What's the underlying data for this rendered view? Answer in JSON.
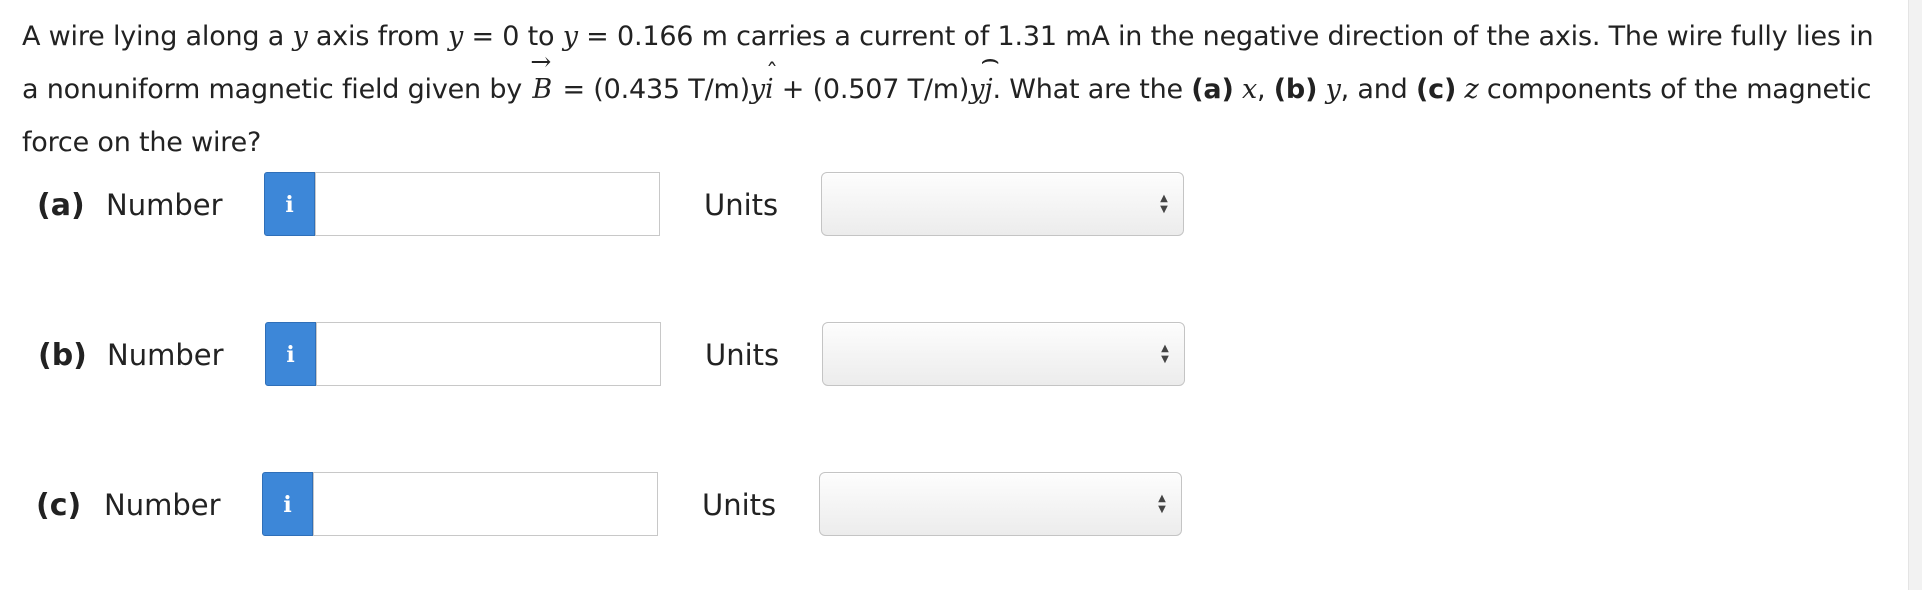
{
  "question": {
    "t1": "A wire lying along a ",
    "var_y1": "y",
    "t2": " axis from ",
    "var_y2": "y",
    "t3": " = 0 to ",
    "var_y3": "y",
    "t4": " = 0.166 m carries a current of 1.31 mA in the negative direction of the axis. The wire fully lies in a nonuniform magnetic field given by ",
    "var_B": "B",
    "t5": " = (0.435 T/m)",
    "var_y4": "y",
    "var_i": "i",
    "t6": " + (0.507 T/m)",
    "var_y5": "y",
    "var_j": "j",
    "t7": ". What are the ",
    "a_tag": "(a)",
    "var_x": " x",
    "t8": ", ",
    "b_tag": "(b)",
    "var_y6": " y",
    "t9": ", and ",
    "c_tag": "(c)",
    "var_z": " z",
    "t10": " components of the magnetic force on the wire?"
  },
  "rows": [
    {
      "label": "(a)",
      "number_label": "Number",
      "info_icon": "info-icon",
      "input_value": "",
      "units_label": "Units",
      "units_selected": ""
    },
    {
      "label": "(b)",
      "number_label": "Number",
      "info_icon": "info-icon",
      "input_value": "",
      "units_label": "Units",
      "units_selected": ""
    },
    {
      "label": "(c)",
      "number_label": "Number",
      "info_icon": "info-icon",
      "input_value": "",
      "units_label": "Units",
      "units_selected": ""
    }
  ],
  "info_glyph": "i",
  "colors": {
    "info_button": "#3d87d8",
    "text": "#222222"
  }
}
